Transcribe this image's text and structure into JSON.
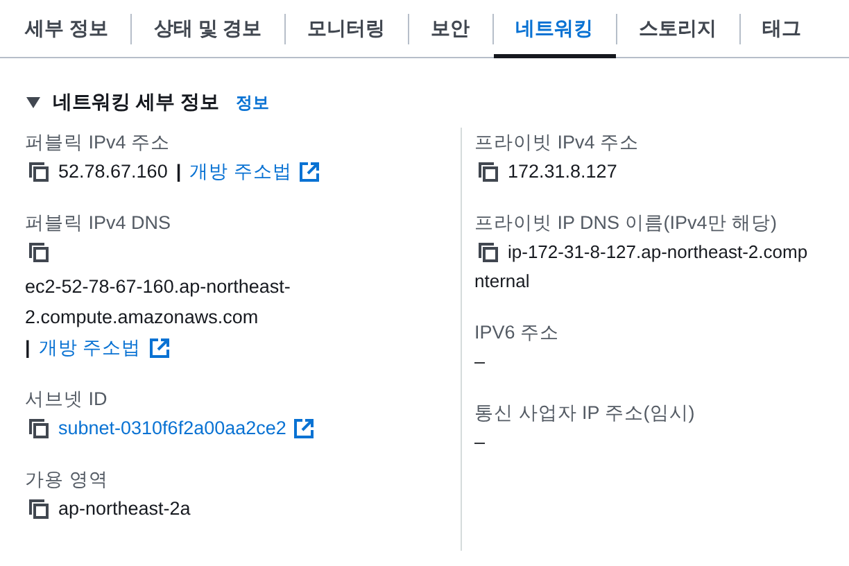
{
  "tabs": [
    {
      "label": "세부 정보",
      "selected": false
    },
    {
      "label": "상태 및 경보",
      "selected": false
    },
    {
      "label": "모니터링",
      "selected": false
    },
    {
      "label": "보안",
      "selected": false
    },
    {
      "label": "네트워킹",
      "selected": true
    },
    {
      "label": "스토리지",
      "selected": false
    },
    {
      "label": "태그",
      "selected": false
    }
  ],
  "section": {
    "title": "네트워킹 세부 정보",
    "expanded": true,
    "info_link": "정보"
  },
  "columns": [
    [
      {
        "kind": "copy_text",
        "label": "퍼블릭 IPv4 주소",
        "value": "52.78.67.160",
        "separator": "|",
        "link": "개방 주소법"
      },
      {
        "kind": "copy_block",
        "label": "퍼블릭 IPv4 DNS",
        "value_lines": [
          "ec2-52-78-67-160.ap-northeast-",
          "2.compute.amazonaws.com"
        ],
        "separator": "|",
        "link": "개방 주소법"
      },
      {
        "kind": "copy_link",
        "label": "서브넷 ID",
        "link": "subnet-0310f6f2a00aa2ce2"
      },
      {
        "kind": "copy_text",
        "label": "가용 영역",
        "value": "ap-northeast-2a"
      }
    ],
    [
      {
        "kind": "copy_text",
        "label": "프라이빗 IPv4 주소",
        "value": "172.31.8.127"
      },
      {
        "kind": "copy_lines",
        "label": "프라이빗 IP DNS 이름(IPv4만 해당)",
        "value_lines": [
          "ip-172-31-8-127.ap-northeast-2.comp",
          "nternal"
        ]
      },
      {
        "kind": "plain",
        "label": "IPV6 주소",
        "value": "–"
      },
      {
        "kind": "plain",
        "label": "통신 사업자 IP 주소(임시)",
        "value": "–"
      }
    ]
  ]
}
